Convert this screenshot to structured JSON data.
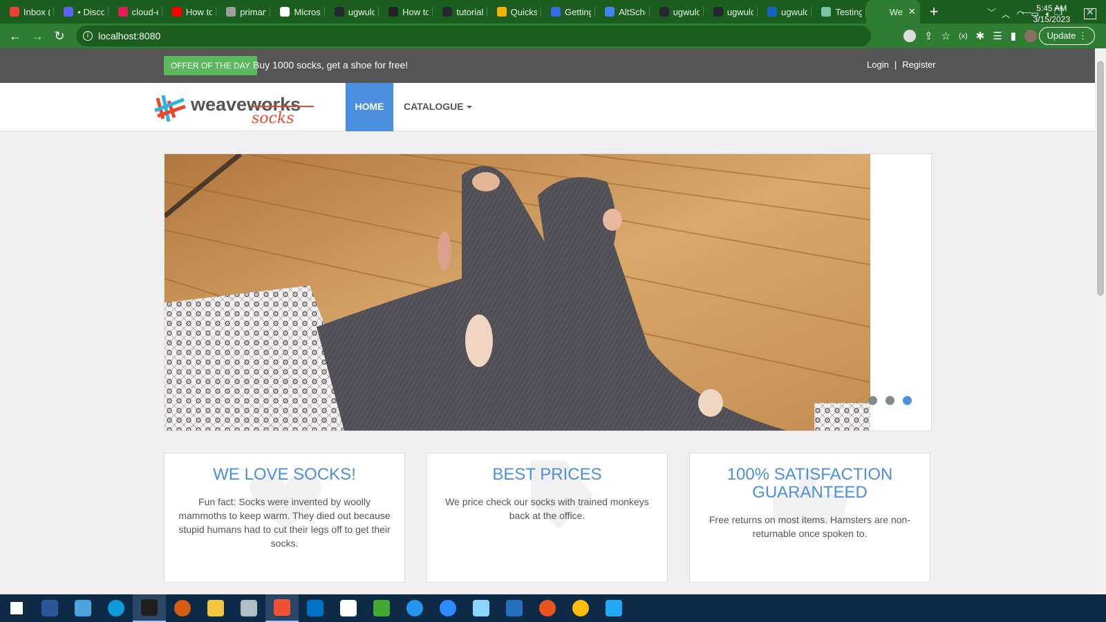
{
  "browser": {
    "tabs": [
      {
        "label": "Inbox (",
        "color": "#ea4335"
      },
      {
        "label": "• Disco",
        "color": "#5865f2"
      },
      {
        "label": "cloud-e",
        "color": "#e01e5a"
      },
      {
        "label": "How to",
        "color": "#ff0000"
      },
      {
        "label": "priman",
        "color": "#9e9e9e"
      },
      {
        "label": "Micros",
        "color": "#ffffff"
      },
      {
        "label": "ugwulc",
        "color": "#24292f"
      },
      {
        "label": "How to",
        "color": "#222222"
      },
      {
        "label": "tutorial",
        "color": "#24292f"
      },
      {
        "label": "Quickst",
        "color": "#f4b400"
      },
      {
        "label": "Getting",
        "color": "#326ce5"
      },
      {
        "label": "AltSchc",
        "color": "#4285f4"
      },
      {
        "label": "ugwulc",
        "color": "#24292f"
      },
      {
        "label": "ugwulc",
        "color": "#24292f"
      },
      {
        "label": "ugwulc",
        "color": "#1565c0"
      },
      {
        "label": "Testing",
        "color": "#7cc4a3"
      },
      {
        "label": "We",
        "color": "#2e7d32",
        "active": true
      }
    ],
    "url": "localhost:8080",
    "update_label": "Update"
  },
  "topbar": {
    "offer_badge": "OFFER OF THE DAY",
    "offer_text": "Buy 1000 socks, get a shoe for free!",
    "login": "Login",
    "separator": "|",
    "register": "Register"
  },
  "navbar": {
    "logo_main": "weaveworks",
    "logo_sub": "socks",
    "home": "HOME",
    "catalogue": "CATALOGUE"
  },
  "carousel": {
    "slide_count": 3,
    "active_index": 2
  },
  "features": [
    {
      "title": "WE LOVE SOCKS!",
      "text": "Fun fact: Socks were invented by woolly mammoths to keep warm. They died out because stupid humans had to cut their legs off to get their socks."
    },
    {
      "title": "BEST PRICES",
      "text": "We price check our socks with trained monkeys back at the office."
    },
    {
      "title": "100% SATISFACTION GUARANTEED",
      "text": "Free returns on most items. Hamsters are non-returnable once spoken to."
    }
  ],
  "taskbar": {
    "apps": [
      {
        "name": "windows-start-icon",
        "color": "#ffffff"
      },
      {
        "name": "word-icon",
        "color": "#2b579a"
      },
      {
        "name": "calculator-icon",
        "color": "#4aa3df"
      },
      {
        "name": "edge-icon",
        "color": "#0f9bd7"
      },
      {
        "name": "terminal-icon",
        "color": "#1e1e1e"
      },
      {
        "name": "media-icon",
        "color": "#d65d0e"
      },
      {
        "name": "file-explorer-icon",
        "color": "#f4c542"
      },
      {
        "name": "settings-app-icon",
        "color": "#b0bec5"
      },
      {
        "name": "git-gui-icon",
        "color": "#f05033"
      },
      {
        "name": "outlook-icon",
        "color": "#0072c6"
      },
      {
        "name": "headset-icon",
        "color": "#ffffff"
      },
      {
        "name": "git-icon",
        "color": "#44a833"
      },
      {
        "name": "docker-icon",
        "color": "#2496ed"
      },
      {
        "name": "zoom-icon",
        "color": "#2d8cff"
      },
      {
        "name": "notes-icon",
        "color": "#8fd3ff"
      },
      {
        "name": "powershell-icon",
        "color": "#2671be"
      },
      {
        "name": "ubuntu-icon",
        "color": "#e95420"
      },
      {
        "name": "chrome-icon",
        "color": "#fbbc05"
      },
      {
        "name": "vscode-icon",
        "color": "#23a9f2"
      }
    ],
    "time": "5:45 AM",
    "date": "3/15/2023"
  }
}
